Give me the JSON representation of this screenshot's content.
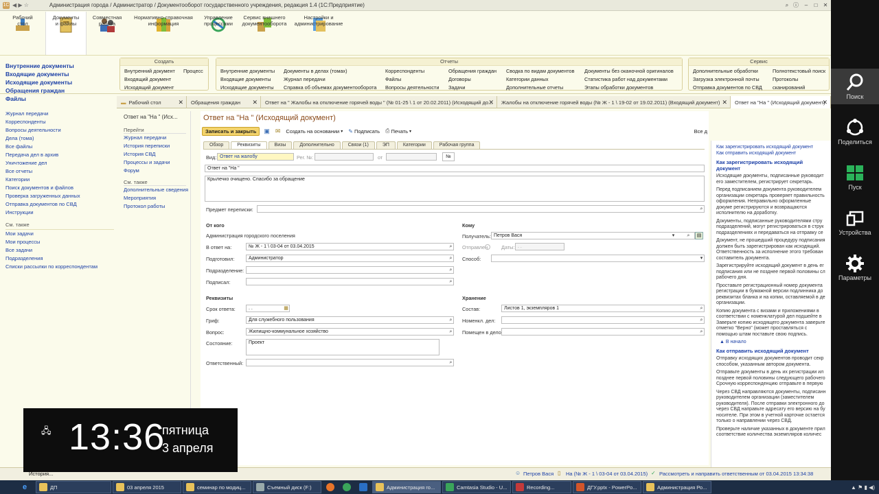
{
  "window": {
    "title": "Администрация города / Администратор / Документооборот государственного учреждения, редакция 1.4  (1С:Предприятие)"
  },
  "sections": [
    {
      "label": "Рабочий\nстол",
      "icon": "desk-icon"
    },
    {
      "label": "Документы\nи файлы",
      "icon": "documents-icon"
    },
    {
      "label": "Совместная\nработа",
      "icon": "users-icon"
    },
    {
      "label": "Нормативно-справочная\nинформация",
      "icon": "books-icon"
    },
    {
      "label": "Управление\nпроцессами",
      "icon": "processes-icon"
    },
    {
      "label": "Сервис внешнего\nдокументооборота",
      "icon": "exchange-icon"
    },
    {
      "label": "Настройки и\nадминистрирование",
      "icon": "settings-docs-icon"
    }
  ],
  "leftnav": {
    "bold": [
      "Внутренние документы",
      "Входящие документы",
      "Исходящие документы",
      "Обращения граждан",
      "Файлы"
    ],
    "links": [
      "Журнал передачи",
      "Корреспонденты",
      "Вопросы деятельности",
      "Дела (тома)",
      "Все файлы",
      "Передача дел в архив",
      "Уничтожение дел",
      "Все отчеты",
      "Категории",
      "Поиск документов и файлов",
      "Проверка загруженных данных",
      "Отправка документов по СВД",
      "Инструкции"
    ],
    "see_also_title": "См. также",
    "see_also": [
      "Мои задачи",
      "Мои процессы",
      "Все задачи",
      "Подразделения",
      "Списки рассылки по корреспондентам"
    ]
  },
  "panels": {
    "create": {
      "title": "Создать",
      "col1": [
        "Внутренний документ",
        "Входящий документ",
        "Исходящий документ"
      ],
      "col2": [
        "Процесс"
      ]
    },
    "reports": {
      "title": "Отчеты",
      "col1": [
        "Внутренние документы",
        "Входящие документы",
        "Исходящие документы"
      ],
      "col2": [
        "Документы в делах (томах)",
        "Журнал передачи",
        "Справка об объемах документооборота"
      ],
      "col3": [
        "Корреспонденты",
        "Файлы",
        "Вопросы деятельности"
      ],
      "col4": [
        "Обращения граждан",
        "Договоры",
        "Задачи"
      ],
      "col5": [
        "Сводка по видам документов",
        "Категории данных",
        "Дополнительные отчеты"
      ],
      "col6": [
        "Документы без оканочной оригиналов",
        "Статистика работ над документами",
        "Этапы обработки документов"
      ]
    },
    "service": {
      "title": "Сервис",
      "col1": [
        "Дополнительные обработки",
        "Загрузка электронной почты",
        "Отправка документов по СВД"
      ],
      "col2": [
        "Полнотекстовый поиск",
        "Протоколы сканирований"
      ]
    }
  },
  "tabs": [
    "Рабочий стол",
    "Обращения граждан",
    "Ответ на \" Жалобы на отключение горячей воды \" (№ 01-25 \\ 1 от 20.02.2011) (Исходящий до...",
    "Жалобы на отключение горячей воды (№ Ж - 1 \\ 19-02 от 19.02.2011) (Входящий документ)",
    "Ответ на \"На \" (Исходящий документ)"
  ],
  "sidecol": {
    "title": "Ответ на \"На \" (Исх...",
    "goto": "Перейти",
    "links": [
      "Журнал передачи",
      "История переписки",
      "История СВД",
      "Процессы и задачи",
      "Форум"
    ],
    "see_also": "См. также",
    "links2": [
      "Дополнительные сведения",
      "Мероприятия",
      "Протокол работы"
    ]
  },
  "form": {
    "title": "Ответ на \"На \" (Исходящий документ)",
    "toolbar": {
      "save_close": "Записать и закрыть",
      "create_base": "Создать на основании",
      "sign": "Подписать",
      "print": "Печать",
      "all_actions": "Все д"
    },
    "tabs": [
      "Обзор",
      "Реквизиты",
      "Визы",
      "Дополнительно",
      "Связи (1)",
      "ЭП",
      "Категории",
      "Рабочая группа"
    ],
    "vid_label": "Вид:",
    "vid_value": "Ответ на жалобу",
    "reg_label": "Рег. №:",
    "ot_label": "от",
    "num_btn": "№",
    "header_value": "Ответ на \"На \"",
    "summary": "Крылечко очищено. Спасибо за обращение",
    "subject_label": "Предмет переписки:",
    "from": {
      "title": "От кого",
      "org": "Администрация городского поселения",
      "reply_label": "В ответ на:",
      "reply": "№ Ж - 1 \\ 03-04 от 03.04.2015",
      "prepared_label": "Подготовил:",
      "prepared": "Администратор",
      "division_label": "Подразделение:",
      "signed_label": "Подписал:"
    },
    "to": {
      "title": "Кому",
      "recipient_label": "Получатель:",
      "recipient": "Петров Вася",
      "sent_label": "Отправлен",
      "date_label": "Даты:",
      "date": " .  . ",
      "method_label": "Способ:"
    },
    "req": {
      "title": "Реквизиты",
      "deadline_label": "Срок ответа:",
      "deadline": " .  . ",
      "stamp_label": "Гриф:",
      "stamp": "Для служебного пользования",
      "question_label": "Вопрос:",
      "question": "Жилищно-коммунальное хозяйство",
      "state_label": "Состояние:",
      "state": "Проект",
      "resp_label": "Ответственный:"
    },
    "storage": {
      "title": "Хранение",
      "content_label": "Состав:",
      "content": "Листов 1, экземпляров 1",
      "nomen_label": "Номенкл. дел:",
      "case_label": "Помещен в дело:"
    }
  },
  "help": {
    "link1": "Как зарегистрировать исходящий документ",
    "link2": "Как отправить исходящий документ",
    "h1": "Как зарегистрировать исходящий документ",
    "p": [
      "Исходящие документы, подписанные руководит его заместителем, регистрирует секретарь.",
      "Перед подписанием документа руководителем организации секретарь проверяет правильность оформления. Неправильно оформленные докуме регистрируются и возвращаются исполнителю на доработку.",
      "Документы, подписанные руководителями стру подразделений, могут регистрироваться в струк подразделениях и передаваться на отправку се",
      "Документ, не прошедший процедуру подписания должен быть зарегистрирован как исходящий. Ответственность за исполнение этого требован составитель документа.",
      "Зарегистрируйте исходящий документ в день ег подписания или не позднее первой половины сл рабочего дня.",
      "Проставьте регистрационный номер документа регистрации в бумажной версии подлинника до реквизитах бланка и на копии, оставляемой в де организации.",
      "Копию документа с визами и приложениями в соответствии с номенклатурой дел подшейте в Заверьте копию исходящего документа заверьте отметко \"Верно\" (может проставляться с помощью штам поставьте свою подпись."
    ],
    "back": "В начало",
    "h2": "Как отправить исходящий документ",
    "p2": [
      "Отправку исходящих документов проводит секр способом, указанным автором документа.",
      "Отправьте документы в день их регистрации ил позднее первой половины следующего рабочего Срочную корреспонденцию отправьте в первую",
      "Через СВД направляются документы, подписанн руководителем организации (заместителем руководителя). После отправки электронного до через СВД направьте адресату его версию на бу носителе. При этом в учетной карточке остается только о направлении через СВД.",
      "Проверьте наличие указанных в документе прил соответствие количества экземпляров количес"
    ]
  },
  "status": {
    "history": "История...",
    "user": "Петров Вася",
    "doc": "На (№ Ж - 1 \\ 03-04 от 03.04.2015)",
    "task": "Рассмотреть и направить ответственным от 03.04.2015 13:34:38"
  },
  "charms": [
    {
      "label": "Поиск",
      "icon": "search-icon"
    },
    {
      "label": "Поделиться",
      "icon": "share-icon"
    },
    {
      "label": "Пуск",
      "icon": "windows-icon"
    },
    {
      "label": "Устройства",
      "icon": "devices-icon"
    },
    {
      "label": "Параметры",
      "icon": "gear-icon"
    }
  ],
  "clock": {
    "time": "13:36",
    "weekday": "пятница",
    "date": "3 апреля"
  },
  "taskbar": [
    "ДП",
    "03 апреля 2015",
    "семинар по модиц...",
    "Съемный диск (F:)",
    "",
    "",
    "",
    "Администрация го...",
    "Camtasia Studio - U...",
    "Recording...",
    "ДГУ.pptx - PowerPo...",
    "Администрация Ро..."
  ]
}
